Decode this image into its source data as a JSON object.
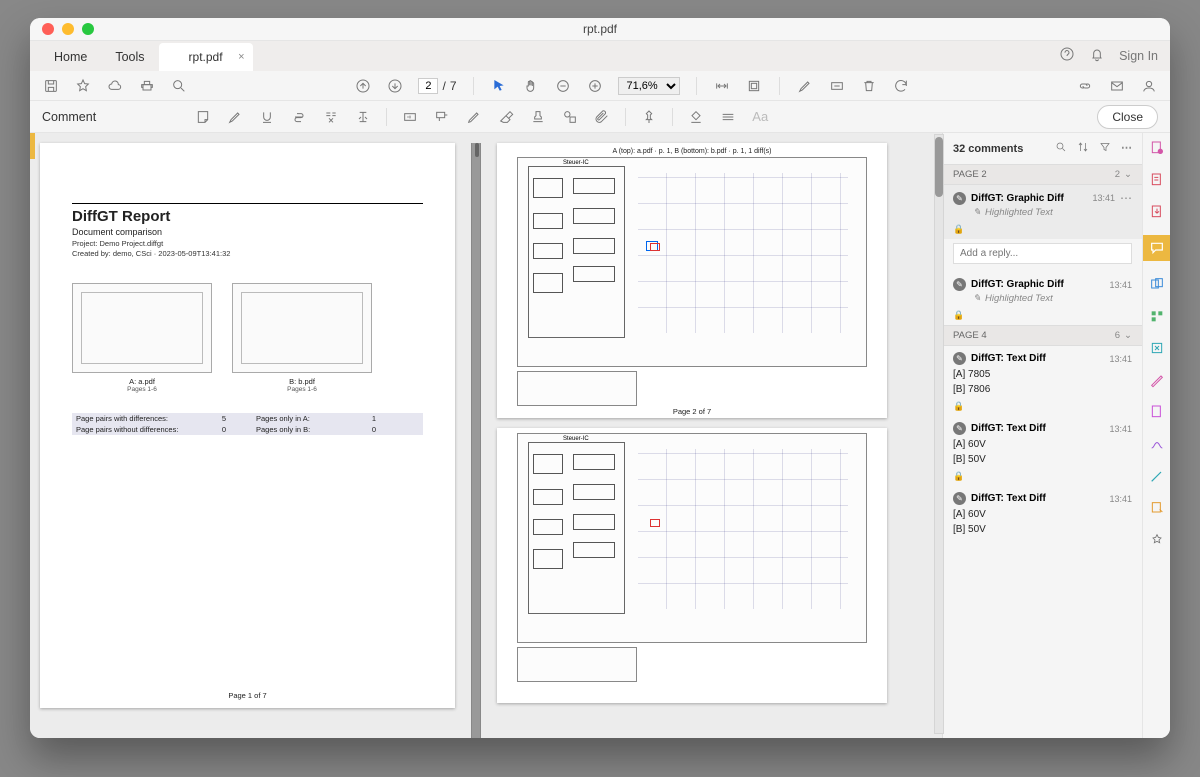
{
  "window": {
    "title": "rpt.pdf"
  },
  "tabs": {
    "home": "Home",
    "tools": "Tools",
    "doc": "rpt.pdf"
  },
  "account": {
    "signin": "Sign In"
  },
  "toolbar": {
    "page_current": "2",
    "page_sep": "/",
    "page_total": "7",
    "zoom": "71,6%"
  },
  "subbar": {
    "label": "Comment",
    "close": "Close"
  },
  "comments_panel": {
    "header": "32 comments",
    "sections": [
      {
        "label": "PAGE 2",
        "count": "2",
        "items": [
          {
            "name": "DiffGT: Graphic Diff",
            "time": "13:41",
            "sub": "Highlighted Text",
            "lock": true,
            "selected": true,
            "reply": "Add a reply..."
          },
          {
            "name": "DiffGT: Graphic Diff",
            "time": "13:41",
            "sub": "Highlighted Text",
            "lock": true
          }
        ]
      },
      {
        "label": "PAGE 4",
        "count": "6",
        "items": [
          {
            "name": "DiffGT: Text Diff",
            "time": "13:41",
            "body1": "[A] 7805",
            "body2": "[B] 7806",
            "lock": true
          },
          {
            "name": "DiffGT: Text Diff",
            "time": "13:41",
            "body1": "[A] 60V",
            "body2": "[B] 50V",
            "lock": true
          },
          {
            "name": "DiffGT: Text Diff",
            "time": "13:41",
            "body1": "[A] 60V",
            "body2": "[B] 50V"
          }
        ]
      }
    ]
  },
  "page1": {
    "title": "DiffGT Report",
    "subtitle": "Document comparison",
    "meta1": "Project: Demo Project.diffgt",
    "meta2": "Created by: demo, CSci · 2023-05-09T13:41:32",
    "thumbA_cap": "A: a.pdf",
    "thumbA_sub": "Pages 1-6",
    "thumbB_cap": "B: b.pdf",
    "thumbB_sub": "Pages 1-6",
    "stat1_l": "Page pairs with differences:",
    "stat1_v": "5",
    "stat2_l": "Page pairs without differences:",
    "stat2_v": "0",
    "stat3_l": "Pages only in A:",
    "stat3_v": "1",
    "stat4_l": "Pages only in B:",
    "stat4_v": "0",
    "footer": "Page 1 of 7"
  },
  "page2": {
    "header": "A (top): a.pdf · p. 1, B (bottom): b.pdf · p. 1, 1 diff(s)",
    "steuer": "Steuer-IC",
    "footer": "Page 2 of 7"
  },
  "page3": {
    "steuer": "Steuer-IC"
  }
}
